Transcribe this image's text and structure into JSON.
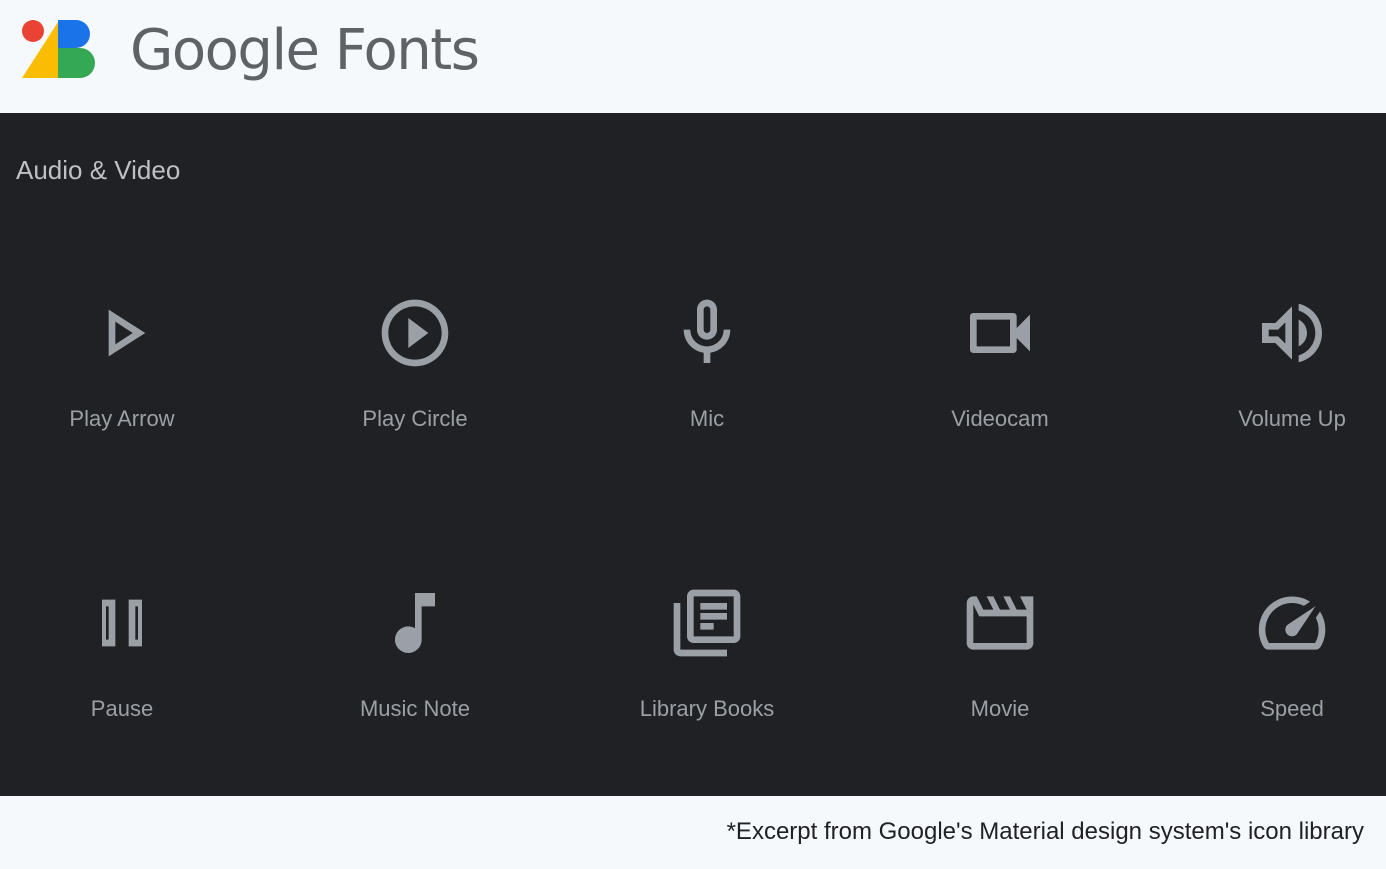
{
  "header": {
    "brand_title": "Google Fonts",
    "logo_colors": {
      "red": "#ea4335",
      "yellow": "#fbbc04",
      "blue": "#1a73e8",
      "green": "#34a853"
    }
  },
  "section": {
    "title": "Audio & Video"
  },
  "icons": [
    {
      "label": "Play Arrow",
      "icon": "play-arrow-icon"
    },
    {
      "label": "Play Circle",
      "icon": "play-circle-icon"
    },
    {
      "label": "Mic",
      "icon": "mic-icon"
    },
    {
      "label": "Videocam",
      "icon": "videocam-icon"
    },
    {
      "label": "Volume Up",
      "icon": "volume-up-icon"
    },
    {
      "label": "Pause",
      "icon": "pause-icon"
    },
    {
      "label": "Music Note",
      "icon": "music-note-icon"
    },
    {
      "label": "Library Books",
      "icon": "library-books-icon"
    },
    {
      "label": "Movie",
      "icon": "movie-icon"
    },
    {
      "label": "Speed",
      "icon": "speed-icon"
    }
  ],
  "colors": {
    "panel_bg": "#202124",
    "icon": "#9aa0a6",
    "label": "#9aa0a6",
    "section_title": "#bdc1c6"
  },
  "footer": {
    "note": "*Excerpt from Google's Material design system's icon library"
  }
}
